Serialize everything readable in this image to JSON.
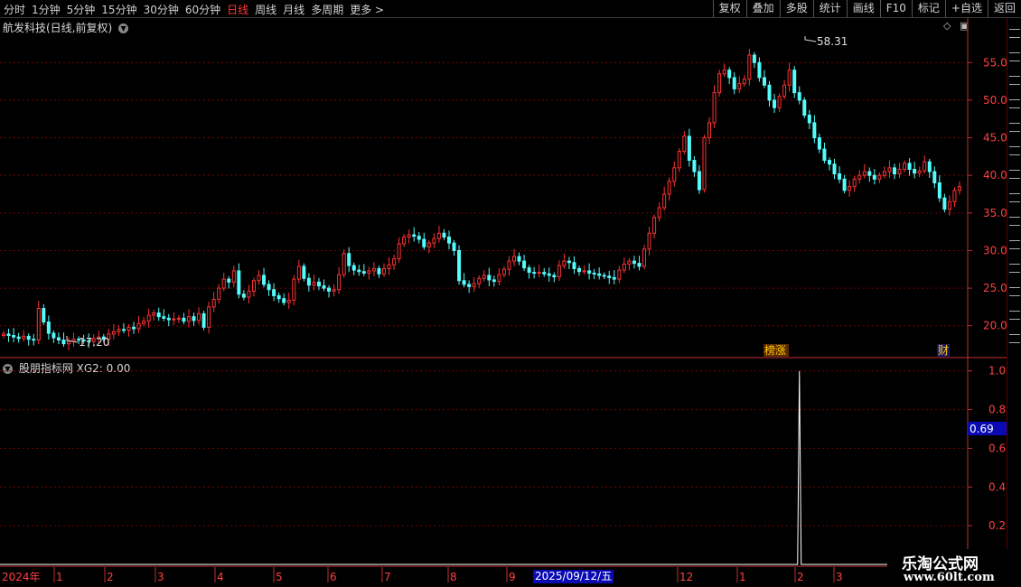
{
  "toolbar": {
    "periods": [
      "分时",
      "1分钟",
      "5分钟",
      "15分钟",
      "30分钟",
      "60分钟",
      "日线",
      "周线",
      "月线",
      "多周期",
      "更多 >"
    ],
    "active_period": "日线",
    "right_buttons": [
      "复权",
      "叠加",
      "多股",
      "统计",
      "画线",
      "F10",
      "标记",
      "+自选",
      "返回"
    ]
  },
  "stock_title": "航发科技(日线,前复权)",
  "indicator_title": "股朋指标网  XG2: 0.00",
  "colors": {
    "up": "#ff3232",
    "down": "#54fcfc",
    "grid": "#7a0000",
    "axis": "#c03030",
    "label": "#ff4040"
  },
  "price_axis": {
    "ticks": [
      "55.00",
      "50.00",
      "45.00",
      "40.00",
      "35.00",
      "30.00",
      "25.00",
      "20.00"
    ]
  },
  "indicator_axis": {
    "ticks": [
      "1.00",
      "0.80",
      "0.60",
      "0.40",
      "0.20"
    ],
    "cursor_value": "0.69"
  },
  "annotations": {
    "high_label": "58.31",
    "low_label": "17.20",
    "tag1": "榜涨",
    "tag2": "财"
  },
  "x_axis": {
    "year_label": "2024年",
    "months": [
      "1",
      "2",
      "3",
      "4",
      "5",
      "6",
      "7",
      "8",
      "9",
      "12",
      "1",
      "2",
      "3"
    ],
    "cursor_date": "2025/09/12/五"
  },
  "watermark": {
    "line1": "乐淘公式网",
    "line2": "www.60lt.com"
  },
  "chart_data": {
    "type": "candlestick",
    "title": "航发科技(日线,前复权)",
    "price_range": [
      16,
      59
    ],
    "high": 58.31,
    "low": 17.2,
    "close_series": [
      18.9,
      18.7,
      18.5,
      18.3,
      18.6,
      18.2,
      18.1,
      22.3,
      20.5,
      19.0,
      18.4,
      18.1,
      17.6,
      17.9,
      18.2,
      18.1,
      18.0,
      17.9,
      18.3,
      18.5,
      18.2,
      18.9,
      19.2,
      19.5,
      19.4,
      19.8,
      19.6,
      20.3,
      20.6,
      21.4,
      21.7,
      21.2,
      21.0,
      20.8,
      20.9,
      21.0,
      20.6,
      21.2,
      20.7,
      21.6,
      19.8,
      22.5,
      23.5,
      25.0,
      26.2,
      25.8,
      27.3,
      24.2,
      23.8,
      24.6,
      26.0,
      26.7,
      25.5,
      24.8,
      24.0,
      23.6,
      23.1,
      23.4,
      26.2,
      27.9,
      26.3,
      25.4,
      25.8,
      25.3,
      25.0,
      24.6,
      24.8,
      26.8,
      29.6,
      28.0,
      27.4,
      27.2,
      27.0,
      27.3,
      27.6,
      26.9,
      27.6,
      28.1,
      28.9,
      30.9,
      31.8,
      32.1,
      31.9,
      31.5,
      30.5,
      31.0,
      31.6,
      32.3,
      31.8,
      31.0,
      30.0,
      26.0,
      25.5,
      25.2,
      25.6,
      26.3,
      26.7,
      26.1,
      25.9,
      26.8,
      27.5,
      28.6,
      29.2,
      28.6,
      27.7,
      27.1,
      27.0,
      27.1,
      26.9,
      26.7,
      26.5,
      28.0,
      28.6,
      28.4,
      27.6,
      27.2,
      27.3,
      27.0,
      26.9,
      26.7,
      26.6,
      26.4,
      26.2,
      27.4,
      28.2,
      28.6,
      28.3,
      27.9,
      30.2,
      32.3,
      34.4,
      35.7,
      37.5,
      39.2,
      41.0,
      43.2,
      45.2,
      42.0,
      40.5,
      38.1,
      45.0,
      47.0,
      51.0,
      53.5,
      54.0,
      53.0,
      51.5,
      52.2,
      52.8,
      56.0,
      55.0,
      53.0,
      52.0,
      50.0,
      49.0,
      50.5,
      52.0,
      54.0,
      51.0,
      50.0,
      48.0,
      47.0,
      45.0,
      43.5,
      42.0,
      41.5,
      40.2,
      39.5,
      38.0,
      38.5,
      39.5,
      40.0,
      40.5,
      40.0,
      39.5,
      40.0,
      40.5,
      41.0,
      40.2,
      40.8,
      41.6,
      40.8,
      40.3,
      40.6,
      41.8,
      40.5,
      39.0,
      37.0,
      35.5,
      36.5,
      38.0,
      38.5
    ],
    "indicator": {
      "name": "XG2",
      "value": 0.0,
      "spike_at_index": 159,
      "spike_value": 1.0,
      "range": [
        0,
        1.05
      ]
    }
  }
}
